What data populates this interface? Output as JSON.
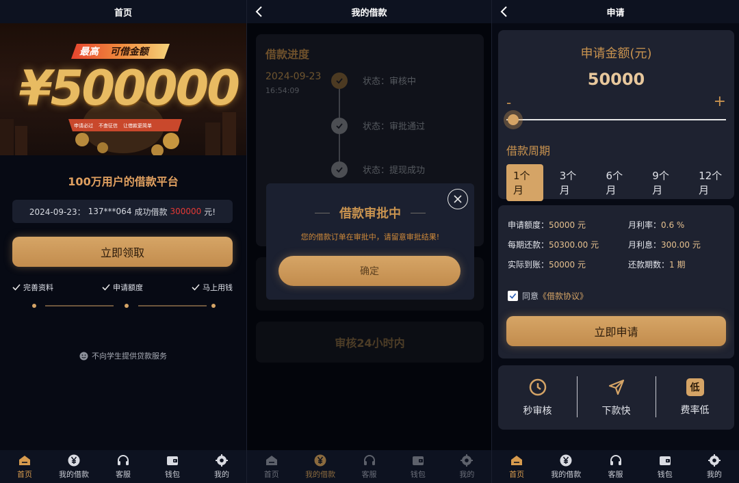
{
  "colors": {
    "accent": "#d5a466",
    "accent_dark": "#c9934f",
    "bg": "#070a14",
    "card": "#1e2230",
    "alert_red": "#e53935"
  },
  "tabs": [
    {
      "label": "首页",
      "icon": "home-icon"
    },
    {
      "label": "我的借款",
      "icon": "yen-coin-icon"
    },
    {
      "label": "客服",
      "icon": "headset-icon"
    },
    {
      "label": "钱包",
      "icon": "wallet-icon"
    },
    {
      "label": "我的",
      "icon": "gear-icon"
    }
  ],
  "home": {
    "title": "首页",
    "banner": {
      "tag_left": "最高",
      "tag_right": "可借金额",
      "amount": "¥500000",
      "bullets": [
        "申请必过",
        "不查征信",
        "让借款更简单"
      ]
    },
    "slogan": "100万用户的借款平台",
    "ticker": {
      "date": "2024-09-23：",
      "user": "137***064",
      "action": "成功借款",
      "amount": "300000",
      "suffix": "元!"
    },
    "claim_button": "立即领取",
    "steps": [
      "完善资料",
      "申请额度",
      "马上用钱"
    ],
    "notice": "不向学生提供贷款服务"
  },
  "loans": {
    "title": "我的借款",
    "progress_title": "借款进度",
    "date": "2024-09-23",
    "time": "16:54:09",
    "statuses": [
      "状态：审核中",
      "状态：审批通过",
      "状态：提现成功"
    ],
    "review_text": "审核24小时内",
    "modal": {
      "title": "借款审批中",
      "message": "您的借款订单在审批中，请留意审批结果!",
      "confirm": "确定"
    }
  },
  "apply": {
    "title": "申请",
    "amount_title": "申请金额(元)",
    "amount": "50000",
    "minus": "-",
    "plus": "+",
    "slider_fraction": 0.0,
    "period_title": "借款周期",
    "terms": [
      "1个月",
      "3个月",
      "6个月",
      "9个月",
      "12个月"
    ],
    "selected_term": "1个月",
    "details": {
      "amount_label": "申请额度：",
      "amount_value": "50000 元",
      "rate_label": "月利率：",
      "rate_value": "0.6 %",
      "repay_label": "每期还款：",
      "repay_value": "50300.00 元",
      "interest_label": "月利息：",
      "interest_value": "300.00 元",
      "received_label": "实际到账：",
      "received_value": "50000 元",
      "periods_label": "还款期数：",
      "periods_value": "1 期"
    },
    "agree_text": "同意",
    "agree_link": "《借款协议》",
    "agree_checked": true,
    "submit_button": "立即申请",
    "features": [
      "秒审核",
      "下款快",
      "费率低"
    ],
    "low_icon_glyph": "低"
  }
}
